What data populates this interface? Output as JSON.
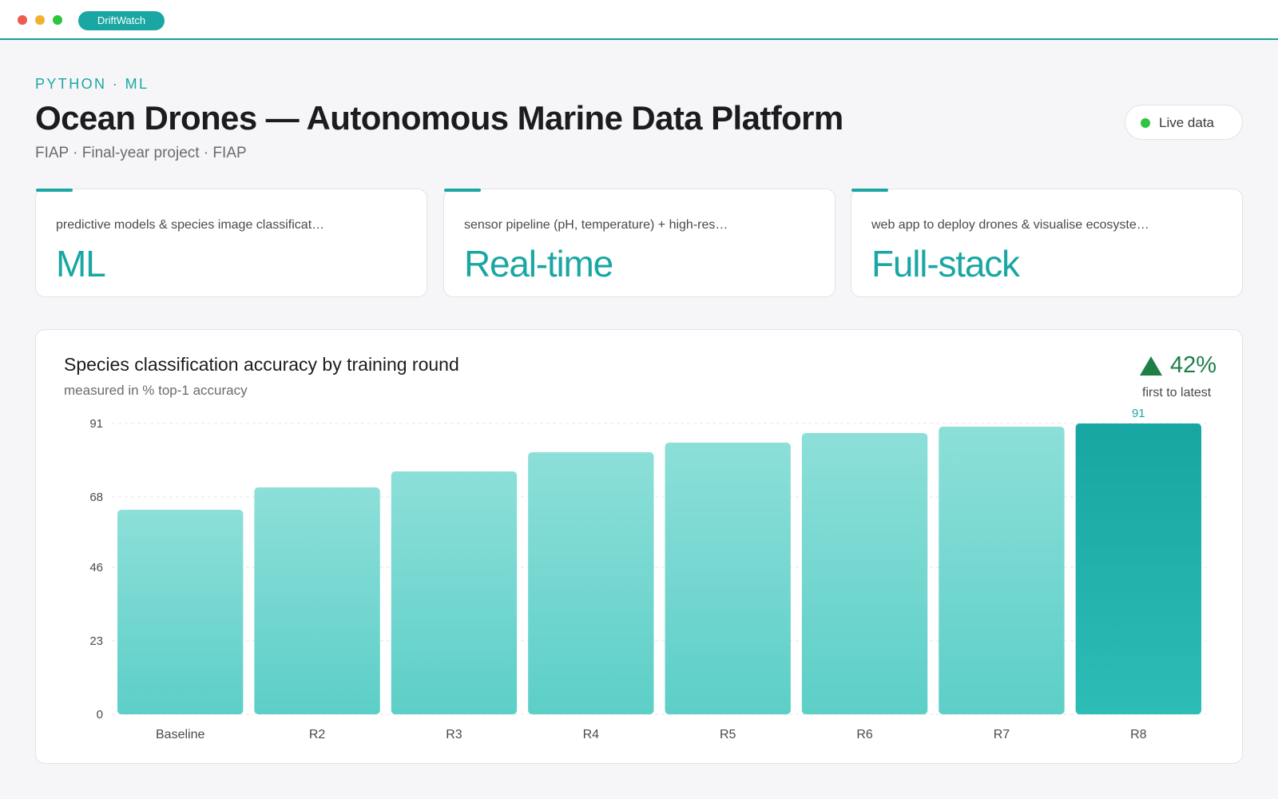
{
  "app": {
    "name": "DriftWatch"
  },
  "header": {
    "eyebrow": "PYTHON · ML",
    "title": "Ocean Drones — Autonomous Marine Data Platform",
    "subtitle": "FIAP · Final-year project · FIAP",
    "live_label": "Live data"
  },
  "cards": [
    {
      "description": "predictive models & species image classificat…",
      "value": "ML"
    },
    {
      "description": "sensor pipeline (pH, temperature) + high-res…",
      "value": "Real-time"
    },
    {
      "description": "web app to deploy drones & visualise ecosyste…",
      "value": "Full-stack"
    }
  ],
  "chart_panel": {
    "title": "Species classification accuracy by training round",
    "subtitle": "measured in % top-1 accuracy",
    "delta_value": "42%",
    "delta_label": "first to latest"
  },
  "chart_data": {
    "type": "bar",
    "title": "Species classification accuracy by training round",
    "subtitle": "measured in % top-1 accuracy",
    "categories": [
      "Baseline",
      "R2",
      "R3",
      "R4",
      "R5",
      "R6",
      "R7",
      "R8"
    ],
    "values": [
      64,
      71,
      76,
      82,
      85,
      88,
      90,
      91
    ],
    "y_ticks": [
      "91",
      "68",
      "46",
      "23",
      "0"
    ],
    "ylim": [
      0,
      91
    ],
    "highlight_index": 7,
    "highlight_label": "91",
    "grid": true,
    "colors": {
      "bar_top": "#8ddfd9",
      "bar_bottom": "#5ccfc7",
      "highlight_top": "#18a6a2",
      "highlight_bottom": "#2dbcb6",
      "label_highlight": "#1aa7a3"
    }
  },
  "colors": {
    "accent": "#1aa7a3",
    "positive": "#1e7f46",
    "live": "#2cc53f"
  }
}
